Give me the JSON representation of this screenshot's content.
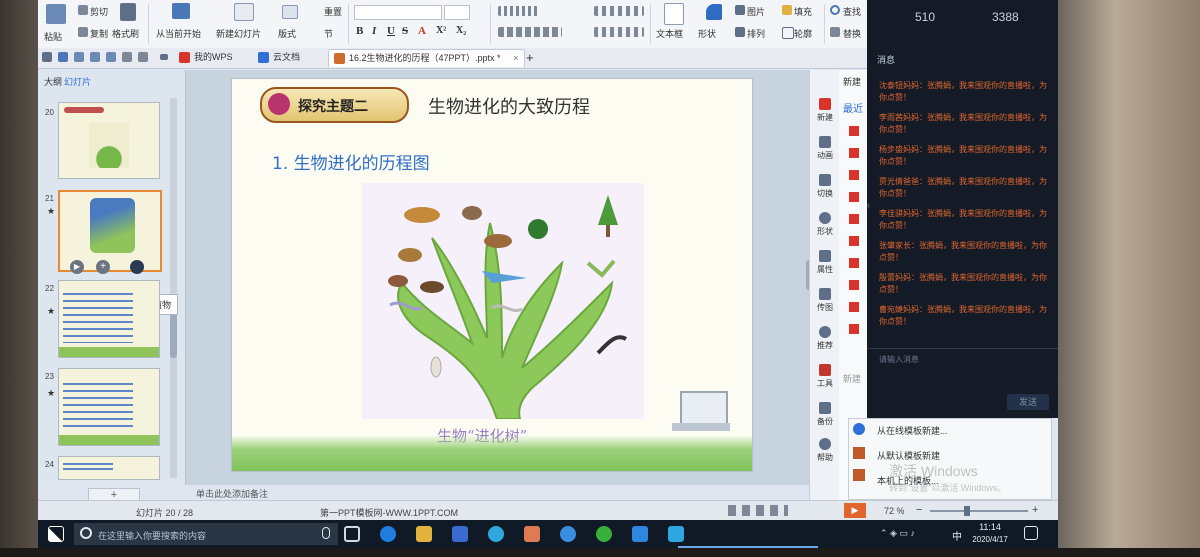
{
  "ribbon": {
    "paste": "粘贴",
    "cut": "剪切",
    "copy": "复制",
    "format_painter": "格式刷",
    "from_start": "从当前开始",
    "new_slide": "新建幻灯片",
    "layout": "版式",
    "section": "节",
    "reset": "重置",
    "textbox": "文本框",
    "shape": "形状",
    "arrange": "排列",
    "picture": "图片",
    "fill": "填充",
    "outline": "轮廓",
    "find": "查找",
    "replace": "替换",
    "format_letters": [
      "B",
      "I",
      "U",
      "S",
      "A",
      "X²",
      "X₂"
    ]
  },
  "tabs": [
    {
      "label": "我的WPS",
      "color": "#d9342b"
    },
    {
      "label": "云文档",
      "color": "#2e6fd8"
    },
    {
      "label": "16.2生物进化的历程（47PPT）.pptx *",
      "color": "#d06a2c"
    }
  ],
  "tabs_new": "+",
  "chat_counts": {
    "left": "510",
    "right": "3388"
  },
  "slides_panel": {
    "tab_outline": "大纲",
    "tab_slides": "幻灯片",
    "numbers": [
      "20",
      "21",
      "22",
      "23",
      "24"
    ],
    "tooltip": "苔藓植物",
    "add": "+"
  },
  "slide": {
    "theme_badge": "探究主题二",
    "title": "生物进化的大致历程",
    "subtitle": "1. 生物进化的历程图",
    "caption": "生物“进化树”"
  },
  "side_tools": [
    "新建",
    "动画",
    "切换",
    "形状",
    "属性",
    "传图",
    "推荐",
    "工具",
    "备份",
    "帮助"
  ],
  "newdoc": {
    "title": "新建",
    "recent": "最近"
  },
  "chat": {
    "header": "消息",
    "messages": [
      "沈泰钮妈妈：张腾娟，我来围观你的直播啦，为你点赞！",
      "李雨茜妈妈：张腾娟，我来围观你的直播啦，为你点赞！",
      "杨步盛妈妈：张腾娟，我来围观你的直播啦，为你点赞！",
      "贾光倩爸爸：张腾娟，我来围观你的直播啦，为你点赞！",
      "李佳骐妈妈：张腾娟，我来围观你的直播啦，为你点赞！",
      "张肇家长：张腾娟，我来围观你的直播啦，为你点赞！",
      "殷蕾妈妈：张腾娟，我来围观你的直播啦，为你点赞！",
      "曹宛婕妈妈：张腾娟，我来围观你的直播啦，为你点赞！"
    ],
    "input_placeholder": "请输入消息",
    "send": "发送",
    "new_label": "新建"
  },
  "templates": {
    "online": "从在线模板新建...",
    "default": "从默认模板新建",
    "local": "本机上的模板...",
    "watermark_1": "激活 Windows",
    "watermark_2": "转到\"设置\"以激活 Windows。"
  },
  "status": {
    "notes": "单击此处添加备注",
    "slide_count": "幻灯片 20 / 28",
    "template": "第一PPT模板网-WWW.1PPT.COM",
    "zoom": "72 %",
    "zoom_minus": "−",
    "zoom_plus": "+"
  },
  "taskbar": {
    "search_placeholder": "在这里输入你要搜索的内容",
    "time": "11:14",
    "date": "2020/4/17",
    "ime": "中"
  }
}
